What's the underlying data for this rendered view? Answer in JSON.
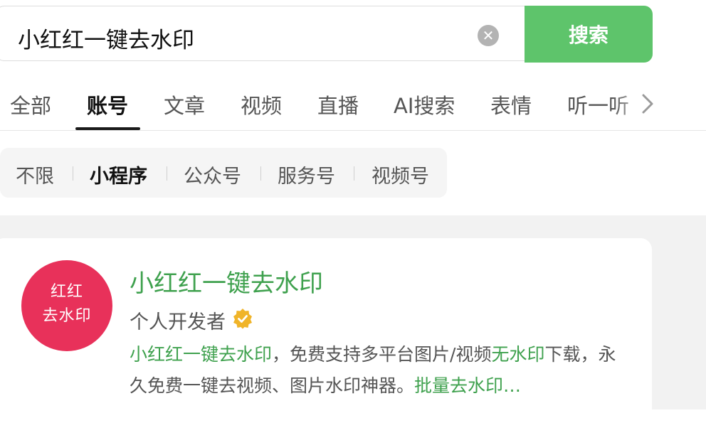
{
  "search": {
    "query": "小红红一键去水印",
    "button_label": "搜索"
  },
  "tabs": [
    {
      "label": "全部"
    },
    {
      "label": "账号",
      "active": true
    },
    {
      "label": "文章"
    },
    {
      "label": "视频"
    },
    {
      "label": "直播"
    },
    {
      "label": "AI搜索"
    },
    {
      "label": "表情"
    },
    {
      "label": "听一听"
    }
  ],
  "filters": [
    {
      "label": "不限"
    },
    {
      "label": "小程序",
      "active": true
    },
    {
      "label": "公众号"
    },
    {
      "label": "服务号"
    },
    {
      "label": "视频号"
    }
  ],
  "result": {
    "avatar_text_line1": "红红",
    "avatar_text_line2": "去水印",
    "title": "小红红一键去水印",
    "subtitle": "个人开发者",
    "desc_parts": [
      {
        "text": "小红红一键去水印",
        "highlight": true
      },
      {
        "text": "，免费支持多平台图片/视频",
        "highlight": false
      },
      {
        "text": "无水印",
        "highlight": true
      },
      {
        "text": "下载，永久免费一键去视频、图片水印神器。",
        "highlight": false
      },
      {
        "text": "批量去水印…",
        "highlight": true
      }
    ]
  },
  "colors": {
    "accent_green": "#5ec46b",
    "highlight_green": "#3fa14e",
    "avatar_bg": "#e8315a",
    "verified_badge": "#f0b429"
  },
  "icons": {
    "clear": "clear-icon",
    "chevron": "chevron-right-icon",
    "verified": "verified-icon"
  }
}
